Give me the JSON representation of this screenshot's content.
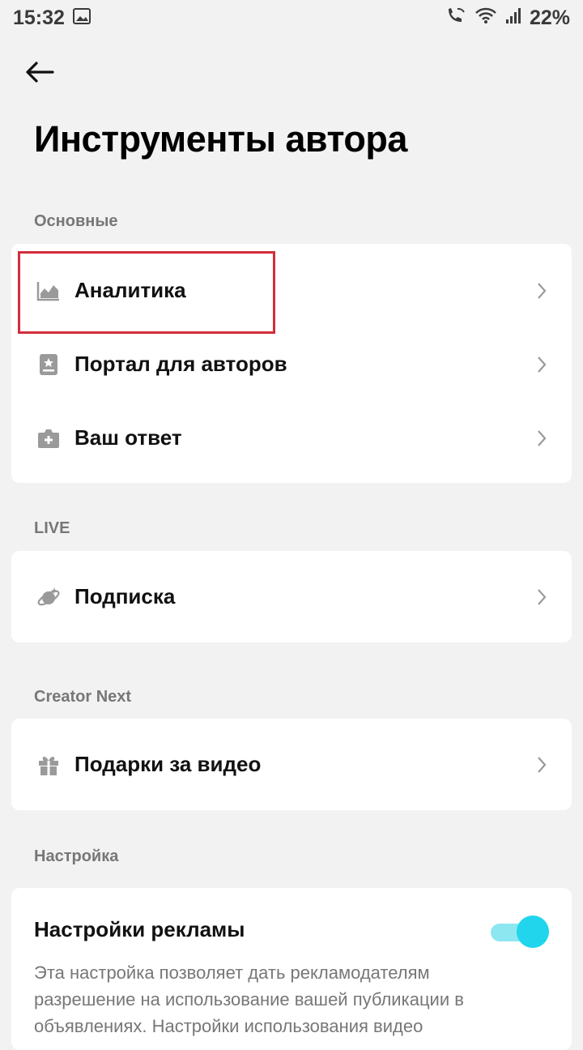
{
  "status_bar": {
    "time": "15:32",
    "battery": "22%",
    "icons": [
      "image-icon",
      "wifi-call-icon",
      "wifi-icon",
      "signal-icon"
    ]
  },
  "header": {
    "back_icon": "arrow-left-icon",
    "title": "Инструменты автора"
  },
  "sections": {
    "main": {
      "label": "Основные",
      "items": [
        {
          "label": "Аналитика",
          "icon": "analytics-chart-icon"
        },
        {
          "label": "Портал для авторов",
          "icon": "creator-portal-icon"
        },
        {
          "label": "Ваш ответ",
          "icon": "camera-plus-icon"
        }
      ]
    },
    "live": {
      "label": "LIVE",
      "items": [
        {
          "label": "Подписка",
          "icon": "subscription-planet-icon"
        }
      ]
    },
    "creator_next": {
      "label": "Creator Next",
      "items": [
        {
          "label": "Подарки за видео",
          "icon": "gift-icon"
        }
      ]
    },
    "settings": {
      "label": "Настройка",
      "ads": {
        "title": "Настройки рекламы",
        "description": "Эта настройка позволяет дать рекламодателям разрешение на использование вашей публикации в объявлениях. Настройки использования видео",
        "toggle_on": true
      }
    }
  },
  "colors": {
    "background": "#f2f2f2",
    "highlight": "#d22d3a",
    "toggle_accent": "#20d5ec"
  }
}
